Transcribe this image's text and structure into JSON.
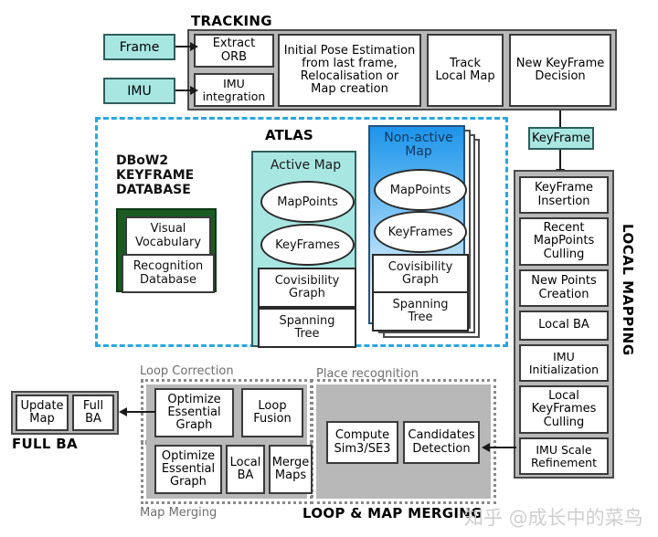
{
  "diagram": {
    "title": "ORB-SLAM3 system overview",
    "colors": {
      "cyan_fill": "#a8e6e2",
      "cyan_border": "#2f5f5c",
      "gray_fill": "#b8b8b8",
      "atlas_dashed": "#29a8e0",
      "dbow_green": "#1c5a24",
      "nonactive_blue": "#1e94ea",
      "dotted_gray": "#8a8a8a"
    }
  },
  "inputs": {
    "frame": "Frame",
    "imu": "IMU"
  },
  "tracking": {
    "title": "TRACKING",
    "boxes": [
      {
        "label": "Extract\nORB"
      },
      {
        "label": "IMU\nintegration"
      },
      {
        "label": "Initial Pose Estimation\nfrom last frame,\nRelocalisation or\nMap creation"
      },
      {
        "label": "Track\nLocal Map"
      },
      {
        "label": "New KeyFrame\nDecision"
      }
    ]
  },
  "atlas": {
    "title": "ATLAS",
    "dbow2": {
      "title": "DBoW2\nKEYFRAME\nDATABASE",
      "items": [
        {
          "label": "Visual\nVocabulary"
        },
        {
          "label": "Recognition\nDatabase"
        }
      ]
    },
    "active_map": {
      "title": "Active Map",
      "ellipses": [
        {
          "label": "MapPoints"
        },
        {
          "label": "KeyFrames"
        }
      ],
      "boxes": [
        {
          "label": "Covisibility\nGraph"
        },
        {
          "label": "Spanning\nTree"
        }
      ]
    },
    "non_active_map": {
      "title": "Non-active\nMap",
      "ellipses": [
        {
          "label": "MapPoints"
        },
        {
          "label": "KeyFrames"
        }
      ],
      "boxes": [
        {
          "label": "Covisibility\nGraph"
        },
        {
          "label": "Spanning\nTree"
        }
      ]
    }
  },
  "keyframe_token": "KeyFrame",
  "local_mapping": {
    "title": "LOCAL MAPPING",
    "boxes": [
      {
        "label": "KeyFrame\nInsertion"
      },
      {
        "label": "Recent\nMapPoints\nCulling"
      },
      {
        "label": "New Points\nCreation"
      },
      {
        "label": "Local BA"
      },
      {
        "label": "IMU\nInitialization"
      },
      {
        "label": "Local\nKeyFrames\nCulling"
      },
      {
        "label": "IMU Scale\nRefinement"
      }
    ]
  },
  "full_ba": {
    "title": "FULL BA",
    "boxes": [
      {
        "label": "Update\nMap"
      },
      {
        "label": "Full\nBA"
      }
    ]
  },
  "loop_merging": {
    "title": "LOOP & MAP MERGING",
    "loop_correction": {
      "title": "Loop Correction",
      "boxes": [
        {
          "label": "Optimize\nEssential\nGraph"
        },
        {
          "label": "Loop\nFusion"
        }
      ]
    },
    "map_merging": {
      "title": "Map Merging",
      "boxes": [
        {
          "label": "Optimize\nEssential\nGraph"
        },
        {
          "label": "Local\nBA"
        },
        {
          "label": "Merge\nMaps"
        }
      ]
    },
    "place_recognition": {
      "title": "Place recognition",
      "boxes": [
        {
          "label": "Compute\nSim3/SE3"
        },
        {
          "label": "Candidates\nDetection"
        }
      ]
    }
  },
  "watermark": "知乎 @成长中的菜鸟"
}
